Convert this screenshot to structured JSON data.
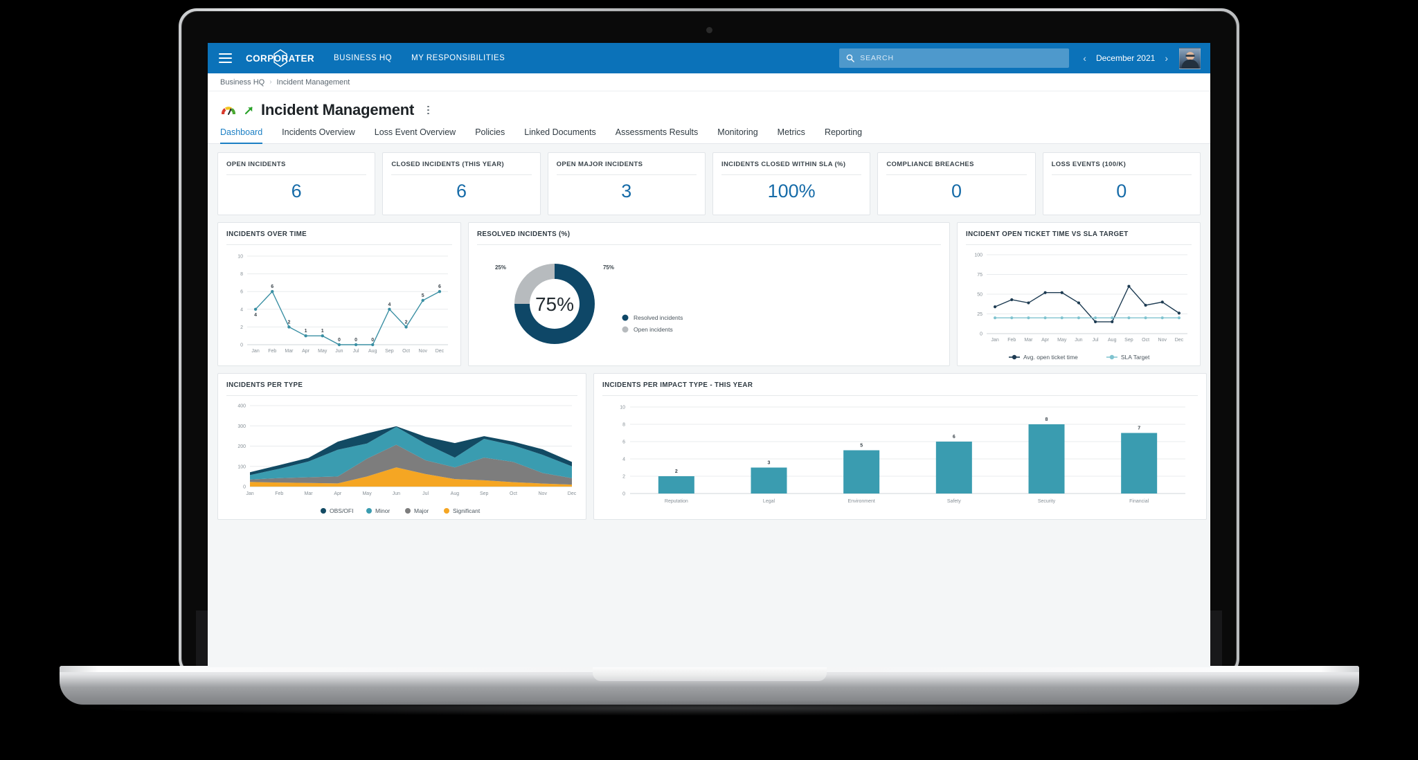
{
  "topbar": {
    "brand": "CORPORATER",
    "nav": [
      {
        "label": "BUSINESS HQ"
      },
      {
        "label": "MY RESPONSIBILITIES"
      }
    ],
    "search": {
      "placeholder": "SEARCH",
      "value": "",
      "icon": "search-icon"
    },
    "period": {
      "prev": "‹",
      "label": "December 2021",
      "next": "›"
    },
    "avatar_alt": "user-avatar",
    "accent_color": "#0b72b9"
  },
  "breadcrumb": {
    "items": [
      "Business HQ",
      "Incident Management"
    ],
    "separator": "›"
  },
  "page": {
    "title": "Incident Management",
    "status_icon": "gauge-icon",
    "trend_icon": "arrow-up-right-icon",
    "menu_icon": "kebab-menu-icon"
  },
  "tabs": [
    {
      "label": "Dashboard",
      "active": true
    },
    {
      "label": "Incidents Overview",
      "active": false
    },
    {
      "label": "Loss Event Overview",
      "active": false
    },
    {
      "label": "Policies",
      "active": false
    },
    {
      "label": "Linked Documents",
      "active": false
    },
    {
      "label": "Assessments Results",
      "active": false
    },
    {
      "label": "Monitoring",
      "active": false
    },
    {
      "label": "Metrics",
      "active": false
    },
    {
      "label": "Reporting",
      "active": false
    }
  ],
  "kpis": [
    {
      "title": "OPEN INCIDENTS",
      "value": "6"
    },
    {
      "title": "CLOSED INCIDENTS (THIS YEAR)",
      "value": "6"
    },
    {
      "title": "OPEN MAJOR INCIDENTS",
      "value": "3"
    },
    {
      "title": "INCIDENTS CLOSED WITHIN SLA (%)",
      "value": "100%"
    },
    {
      "title": "COMPLIANCE BREACHES",
      "value": "0"
    },
    {
      "title": "LOSS EVENTS (100/K)",
      "value": "0"
    }
  ],
  "cards": {
    "incidents_over_time": "INCIDENTS OVER TIME",
    "resolved_incidents": "RESOLVED INCIDENTS (%)",
    "sla_target": "INCIDENT OPEN TICKET TIME VS SLA TARGET",
    "incidents_per_type": "INCIDENTS PER TYPE",
    "incidents_per_impact": "INCIDENTS PER IMPACT TYPE - THIS YEAR"
  },
  "colors": {
    "kpi_value": "#166ba8",
    "teal": "#3a9cb0",
    "navy": "#124a63",
    "gray": "#7d7d7d",
    "orange": "#f5a623",
    "light_teal": "#7fc3cf",
    "donut_dark": "#0e4767",
    "donut_gray": "#b7bbbe"
  },
  "chart_data": [
    {
      "id": "incidents-over-time",
      "type": "line",
      "title": "INCIDENTS OVER TIME",
      "categories": [
        "Jan",
        "Feb",
        "Mar",
        "Apr",
        "May",
        "Jun",
        "Jul",
        "Aug",
        "Sep",
        "Oct",
        "Nov",
        "Dec"
      ],
      "values": [
        4,
        6,
        2,
        1,
        1,
        0,
        0,
        0,
        4,
        2,
        5,
        6
      ],
      "point_labels": [
        "4",
        "6",
        "2",
        "1",
        "1",
        "0",
        "0",
        "0",
        "4",
        "2",
        "5",
        "6"
      ],
      "yticks": [
        0,
        2,
        4,
        6,
        8,
        10
      ],
      "ylim": [
        0,
        10
      ],
      "xlabel": "",
      "ylabel": "",
      "grid": true,
      "series_color": "#3a8fa3"
    },
    {
      "id": "resolved-incidents",
      "type": "pie",
      "title": "RESOLVED INCIDENTS (%)",
      "center_label": "75%",
      "slices": [
        {
          "name": "Resolved incidents",
          "value": 75,
          "label": "75%",
          "color": "#0e4767"
        },
        {
          "name": "Open incidents",
          "value": 25,
          "label": "25%",
          "color": "#b7bbbe"
        }
      ],
      "legend_position": "right"
    },
    {
      "id": "sla-target",
      "type": "line",
      "title": "INCIDENT OPEN TICKET TIME VS SLA TARGET",
      "categories": [
        "Jan",
        "Feb",
        "Mar",
        "Apr",
        "May",
        "Jun",
        "Jul",
        "Aug",
        "Sep",
        "Oct",
        "Nov",
        "Dec"
      ],
      "series": [
        {
          "name": "Avg. open ticket time",
          "values": [
            34,
            43,
            39,
            52,
            52,
            39,
            15,
            15,
            60,
            36,
            40,
            26
          ],
          "color": "#1d3b52"
        },
        {
          "name": "SLA Target",
          "values": [
            20,
            20,
            20,
            20,
            20,
            20,
            20,
            20,
            20,
            20,
            20,
            20
          ],
          "color": "#7fc3cf"
        }
      ],
      "yticks": [
        0,
        25,
        50,
        75,
        100
      ],
      "ylim": [
        0,
        100
      ],
      "grid": true,
      "legend_position": "bottom"
    },
    {
      "id": "incidents-per-type",
      "type": "area",
      "title": "INCIDENTS PER TYPE",
      "categories": [
        "Jan",
        "Feb",
        "Mar",
        "Apr",
        "May",
        "Jun",
        "Jul",
        "Aug",
        "Sep",
        "Oct",
        "Nov",
        "Dec"
      ],
      "stacked": true,
      "series": [
        {
          "name": "Significant",
          "values": [
            23,
            20,
            18,
            16,
            50,
            95,
            62,
            37,
            31,
            22,
            15,
            10
          ],
          "color": "#f5a623"
        },
        {
          "name": "Major",
          "values": [
            12,
            22,
            28,
            34,
            88,
            112,
            68,
            58,
            112,
            100,
            52,
            32
          ],
          "color": "#7d7d7d"
        },
        {
          "name": "Minor",
          "values": [
            22,
            46,
            78,
            132,
            75,
            88,
            82,
            48,
            93,
            82,
            90,
            58
          ],
          "color": "#3a9cb0"
        },
        {
          "name": "OBS/OFI",
          "values": [
            14,
            18,
            18,
            40,
            50,
            3,
            34,
            72,
            13,
            18,
            27,
            22
          ],
          "color": "#124a63"
        }
      ],
      "yticks": [
        0,
        100,
        200,
        300,
        400
      ],
      "ylim": [
        0,
        400
      ],
      "grid": true,
      "legend_position": "bottom"
    },
    {
      "id": "incidents-per-impact",
      "type": "bar",
      "title": "INCIDENTS PER IMPACT TYPE - THIS YEAR",
      "categories": [
        "Reputation",
        "Legal",
        "Environment",
        "Safety",
        "Security",
        "Financial"
      ],
      "values": [
        2,
        3,
        5,
        6,
        8,
        7
      ],
      "bar_labels": [
        "2",
        "3",
        "5",
        "6",
        "8",
        "7"
      ],
      "yticks": [
        0,
        2,
        4,
        6,
        8,
        10
      ],
      "ylim": [
        0,
        10
      ],
      "grid": true,
      "bar_color": "#3a9cb0"
    }
  ]
}
